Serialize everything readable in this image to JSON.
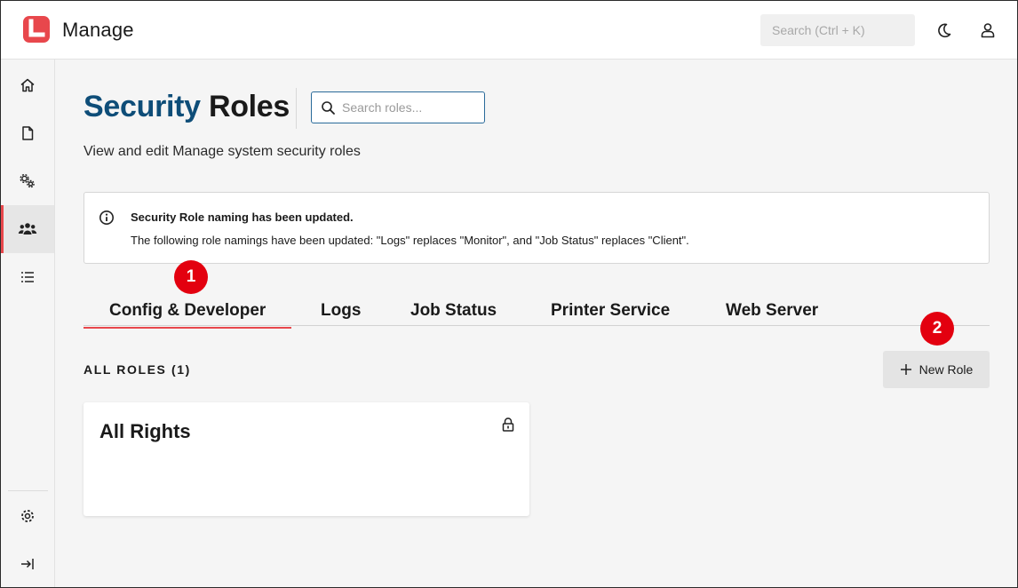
{
  "header": {
    "app_title": "Manage",
    "search_placeholder": "Search (Ctrl + K)",
    "brand_color": "#e8474c"
  },
  "sidebar": {
    "items": [
      {
        "name": "home",
        "icon": "home-icon"
      },
      {
        "name": "documents",
        "icon": "document-icon"
      },
      {
        "name": "settings-services",
        "icon": "gears-icon"
      },
      {
        "name": "security-roles",
        "icon": "users-icon",
        "active": true
      },
      {
        "name": "lists",
        "icon": "list-icon"
      }
    ],
    "bottom": [
      {
        "name": "settings",
        "icon": "gear-icon"
      },
      {
        "name": "collapse",
        "icon": "collapse-icon"
      }
    ]
  },
  "page": {
    "title_part1": "Security",
    "title_part2": "Roles",
    "search_placeholder": "Search roles...",
    "subtitle": "View and edit Manage system security roles"
  },
  "notice": {
    "title": "Security Role naming has been updated.",
    "body": "The following role namings have been updated: \"Logs\" replaces \"Monitor\", and \"Job Status\" replaces \"Client\"."
  },
  "tabs": [
    {
      "label": "Config & Developer",
      "active": true
    },
    {
      "label": "Logs"
    },
    {
      "label": "Job Status"
    },
    {
      "label": "Printer Service"
    },
    {
      "label": "Web Server"
    }
  ],
  "roles": {
    "section_label": "ALL ROLES (1)",
    "new_role_label": "New Role",
    "cards": [
      {
        "title": "All Rights",
        "locked": true
      }
    ]
  },
  "callouts": [
    "1",
    "2"
  ],
  "colors": {
    "accent": "#e8474c",
    "title_blue": "#0e4d78",
    "callout_red": "#e3000f"
  }
}
